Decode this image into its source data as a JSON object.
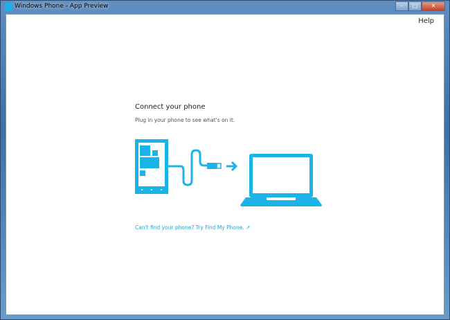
{
  "window": {
    "title": "Windows Phone - App Preview",
    "minimize": "–",
    "maximize": "□",
    "close": "✕"
  },
  "menu": {
    "help": "Help"
  },
  "main": {
    "heading": "Connect your phone",
    "subtitle": "Plug in your phone to see what's on it.",
    "link": "Can't find your phone? Try Find My Phone. ↗"
  },
  "colors": {
    "accent": "#1ab4e8"
  }
}
